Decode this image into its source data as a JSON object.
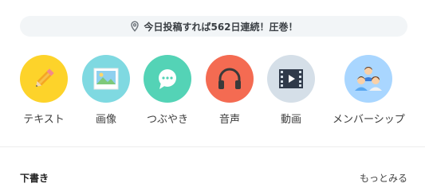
{
  "banner": {
    "text": "今日投稿すれば562日連続！圧巻！",
    "icon": "location-pin-icon"
  },
  "post_types": [
    {
      "label": "テキスト",
      "icon": "pencil-icon",
      "color": "#fdd32a"
    },
    {
      "label": "画像",
      "icon": "image-icon",
      "color": "#7fd9e1"
    },
    {
      "label": "つぶやき",
      "icon": "speech-bubble-icon",
      "color": "#54d3b6"
    },
    {
      "label": "音声",
      "icon": "headphones-icon",
      "color": "#f46b52"
    },
    {
      "label": "動画",
      "icon": "film-icon",
      "color": "#d5dfe8"
    },
    {
      "label": "メンバーシップ",
      "icon": "members-icon",
      "color": "#a9d6ff"
    }
  ],
  "drafts": {
    "title": "下書き",
    "more_label": "もっとみる"
  }
}
